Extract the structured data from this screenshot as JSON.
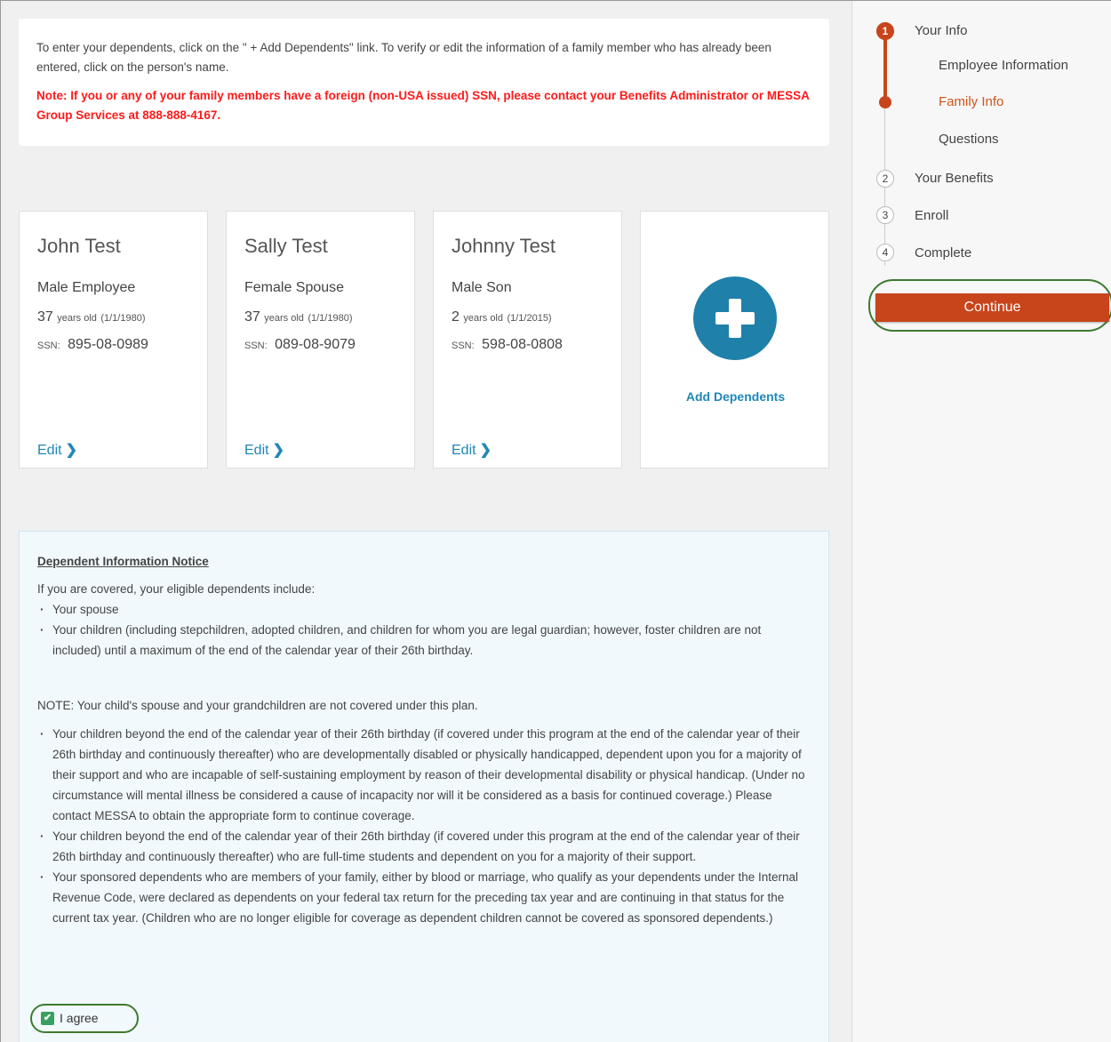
{
  "intro": {
    "text": "To enter your dependents, click on the \" + Add Dependents\" link. To verify or edit the information of a family member who has already been entered, click on the person's name.",
    "note": "Note: If you or any of your family members have a foreign (non-USA issued) SSN, please contact your Benefits Administrator or MESSA Group Services at 888-888-4167."
  },
  "dependents": [
    {
      "name": "John Test",
      "relation": "Male Employee",
      "age": "37",
      "age_unit": "years old",
      "dob": "(1/1/1980)",
      "ssn_label": "SSN:",
      "ssn": "895-08-0989",
      "edit": "Edit"
    },
    {
      "name": "Sally Test",
      "relation": "Female Spouse",
      "age": "37",
      "age_unit": "years old",
      "dob": "(1/1/1980)",
      "ssn_label": "SSN:",
      "ssn": "089-08-9079",
      "edit": "Edit"
    },
    {
      "name": "Johnny Test",
      "relation": "Male Son",
      "age": "2",
      "age_unit": "years old",
      "dob": "(1/1/2015)",
      "ssn_label": "SSN:",
      "ssn": "598-08-0808",
      "edit": "Edit"
    }
  ],
  "add_dependents": {
    "label": "Add Dependents",
    "icon": "plus-circle-icon"
  },
  "notice": {
    "heading": "Dependent Information Notice",
    "intro": "If you are covered, your eligible dependents include:",
    "list1": [
      "Your spouse",
      "Your children (including stepchildren, adopted children, and children for whom you are legal guardian; however, foster children are not included) until a maximum of the end of the calendar year of their 26th birthday."
    ],
    "note": "NOTE: Your child's spouse and your grandchildren are not covered under this plan.",
    "list2": [
      "Your children beyond the end of the calendar year of their 26th birthday (if covered under this program at the end of the calendar year of their 26th birthday and continuously thereafter) who are developmentally disabled or physically handicapped, dependent upon you for a majority of their support and who are incapable of self-sustaining employment by reason of their developmental disability or physical handicap. (Under no circumstance will mental illness be considered a cause of incapacity nor will it be considered as a basis for continued coverage.) Please contact MESSA to obtain the appropriate form to continue coverage.",
      "Your children beyond the end of the calendar year of their 26th birthday (if covered under this program at the end of the calendar year of their 26th birthday and continuously thereafter) who are full-time students and dependent on you for a majority of their support.",
      "Your sponsored dependents who are members of your family, either by blood or marriage, who qualify as your dependents under the Internal Revenue Code, were declared as dependents on your federal tax return for the preceding tax year and are continuing in that status for the current tax year. (Children who are no longer eligible for coverage as dependent children cannot be covered as sponsored dependents.)"
    ],
    "agree_label": "I agree",
    "agree_checked": true
  },
  "stepper": {
    "steps": [
      {
        "number": "1",
        "label": "Your Info",
        "active": true
      },
      {
        "number": "2",
        "label": "Your Benefits"
      },
      {
        "number": "3",
        "label": "Enroll"
      },
      {
        "number": "4",
        "label": "Complete"
      }
    ],
    "substeps": [
      {
        "label": "Employee Information"
      },
      {
        "label": "Family Info",
        "current": true
      },
      {
        "label": "Questions"
      }
    ],
    "continue_label": "Continue"
  },
  "colors": {
    "accent": "#c8441b",
    "link": "#1f87b8",
    "warning": "#ff1a1a",
    "confirm": "#3aa060"
  }
}
